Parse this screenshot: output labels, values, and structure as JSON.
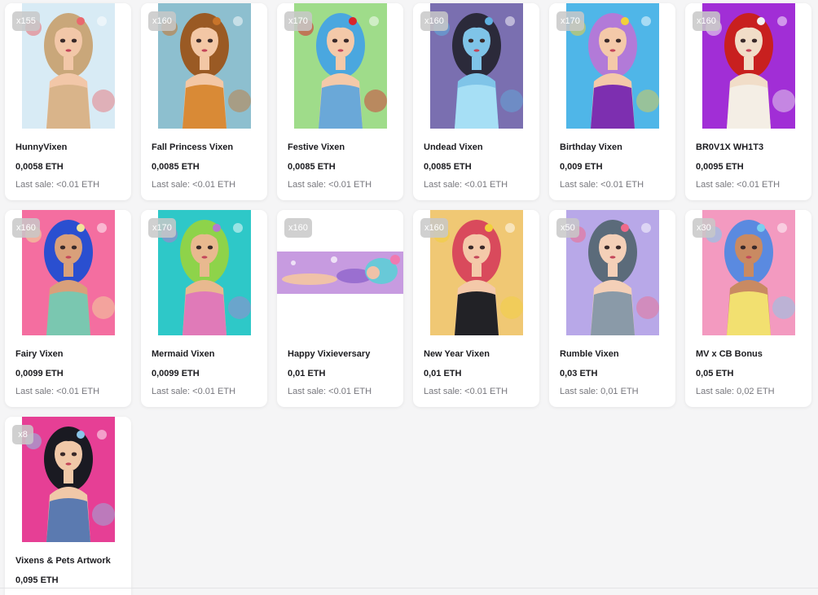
{
  "sale_prefix": "Last sale: ",
  "cards": [
    {
      "badge": "x155",
      "name": "HunnyVixen",
      "price": "0,0058 ETH",
      "last_sale": "<0.01 ETH",
      "art": {
        "bg": "#d8ebf5",
        "hair": "#c9a77a",
        "skin": "#f2c7a8",
        "accent": "#e9686e",
        "outfit": "#d9b48a"
      }
    },
    {
      "badge": "x160",
      "name": "Fall Princess Vixen",
      "price": "0,0085 ETH",
      "last_sale": "<0.01 ETH",
      "art": {
        "bg": "#8dbfcf",
        "hair": "#9a5a24",
        "skin": "#f3c7a5",
        "accent": "#c8742a",
        "outfit": "#d98a36"
      }
    },
    {
      "badge": "x170",
      "name": "Festive Vixen",
      "price": "0,0085 ETH",
      "last_sale": "<0.01 ETH",
      "art": {
        "bg": "#9fdc8a",
        "hair": "#4aa7df",
        "skin": "#f4c9a9",
        "accent": "#d9242b",
        "outfit": "#6aa8d8"
      }
    },
    {
      "badge": "x160",
      "name": "Undead Vixen",
      "price": "0,0085 ETH",
      "last_sale": "<0.01 ETH",
      "art": {
        "bg": "#7a6fb0",
        "hair": "#2b2a3a",
        "skin": "#7fc4e8",
        "accent": "#5fb0e0",
        "outfit": "#a6dff5"
      }
    },
    {
      "badge": "x170",
      "name": "Birthday Vixen",
      "price": "0,009 ETH",
      "last_sale": "<0.01 ETH",
      "art": {
        "bg": "#4fb6e8",
        "hair": "#b27ad8",
        "skin": "#f4c9a9",
        "accent": "#f2d03b",
        "outfit": "#7d2fb0"
      }
    },
    {
      "badge": "x160",
      "name": "BR0V1X WH1T3",
      "price": "0,0095 ETH",
      "last_sale": "<0.01 ETH",
      "art": {
        "bg": "#a12ed6",
        "hair": "#c8201f",
        "skin": "#f1ddc8",
        "accent": "#f2f2f2",
        "outfit": "#f4eee5"
      }
    },
    {
      "badge": "x160",
      "name": "Fairy Vixen",
      "price": "0,0099 ETH",
      "last_sale": "<0.01 ETH",
      "art": {
        "bg": "#f46ea0",
        "hair": "#2a4fd0",
        "skin": "#d9a07a",
        "accent": "#f2e49a",
        "outfit": "#7ac7b0"
      }
    },
    {
      "badge": "x170",
      "name": "Mermaid Vixen",
      "price": "0,0099 ETH",
      "last_sale": "<0.01 ETH",
      "art": {
        "bg": "#2ec8c8",
        "hair": "#8ed34a",
        "skin": "#e8b98f",
        "accent": "#b47ad0",
        "outfit": "#e07ab8"
      }
    },
    {
      "badge": "x160",
      "name": "Happy Vixieversary",
      "price": "0,01 ETH",
      "last_sale": "<0.01 ETH",
      "art": {
        "bg": "#c79be0",
        "hair": "#68c9d8",
        "skin": "#f0c2a8",
        "accent": "#f07ab0",
        "outfit": "#9a6fd0"
      }
    },
    {
      "badge": "x160",
      "name": "New Year Vixen",
      "price": "0,01 ETH",
      "last_sale": "<0.01 ETH",
      "art": {
        "bg": "#f0c874",
        "hair": "#d94a5c",
        "skin": "#f4c9a9",
        "accent": "#f2d03b",
        "outfit": "#222226"
      }
    },
    {
      "badge": "x50",
      "name": "Rumble Vixen",
      "price": "0,03 ETH",
      "last_sale": "0,01 ETH",
      "art": {
        "bg": "#b8a8e8",
        "hair": "#5b6b7a",
        "skin": "#f4d0b8",
        "accent": "#f06a8a",
        "outfit": "#8a9aa8"
      }
    },
    {
      "badge": "x30",
      "name": "MV x CB Bonus",
      "price": "0,05 ETH",
      "last_sale": "0,02 ETH",
      "art": {
        "bg": "#f39ac0",
        "hair": "#5a8ae0",
        "skin": "#c98a62",
        "accent": "#7ad0f0",
        "outfit": "#f2e070"
      }
    },
    {
      "badge": "x8",
      "name": "Vixens & Pets Artwork",
      "price": "0,095 ETH",
      "last_sale": "",
      "art": {
        "bg": "#e63f95",
        "hair": "#1a1a22",
        "skin": "#f0c8a8",
        "accent": "#8ac4e8",
        "outfit": "#5b7ab0"
      }
    }
  ]
}
